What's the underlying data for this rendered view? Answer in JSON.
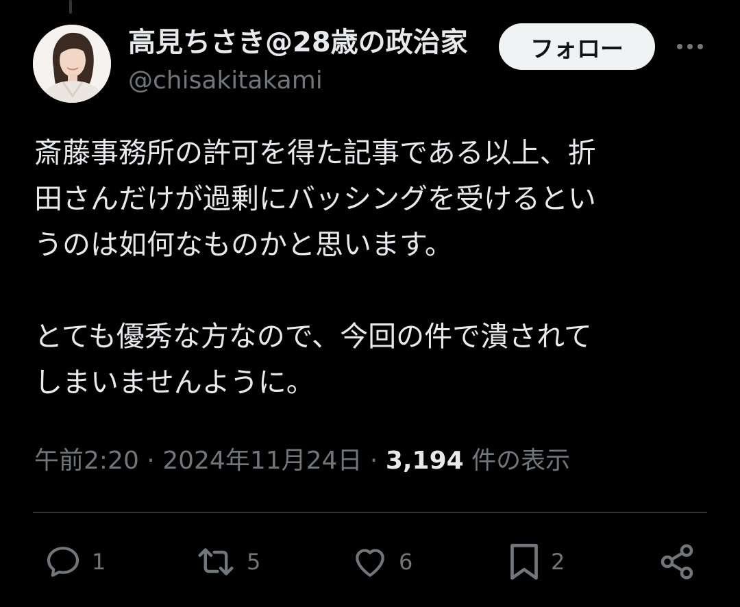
{
  "author": {
    "display_name": "高見ちさき@28歳の政治家",
    "handle": "@chisakitakami"
  },
  "follow_label": "フォロー",
  "more_label": "•••",
  "tweet": {
    "paragraph1_lines": [
      "斎藤事務所の許可を得た記事である以上、折",
      "田さんだけが過剰にバッシングを受けるとい",
      "うのは如何なものかと思います。"
    ],
    "paragraph2_lines": [
      "とても優秀な方なので、今回の件で潰されて",
      "しまいませんように。"
    ]
  },
  "meta": {
    "time": "午前2:20",
    "separator": "·",
    "date": "2024年11月24日",
    "views_count": "3,194",
    "views_label": "件の表示"
  },
  "actions": {
    "reply_count": "1",
    "retweet_count": "5",
    "like_count": "6",
    "bookmark_count": "2"
  },
  "icons": {
    "reply": "reply-icon",
    "retweet": "retweet-icon",
    "like": "heart-icon",
    "bookmark": "bookmark-icon",
    "share": "share-icon",
    "more": "more-icon"
  },
  "colors": {
    "background": "#000000",
    "text_primary": "#e7e9ea",
    "text_secondary": "#71767b",
    "divider": "#2f3336",
    "follow_bg": "#eff3f4"
  }
}
